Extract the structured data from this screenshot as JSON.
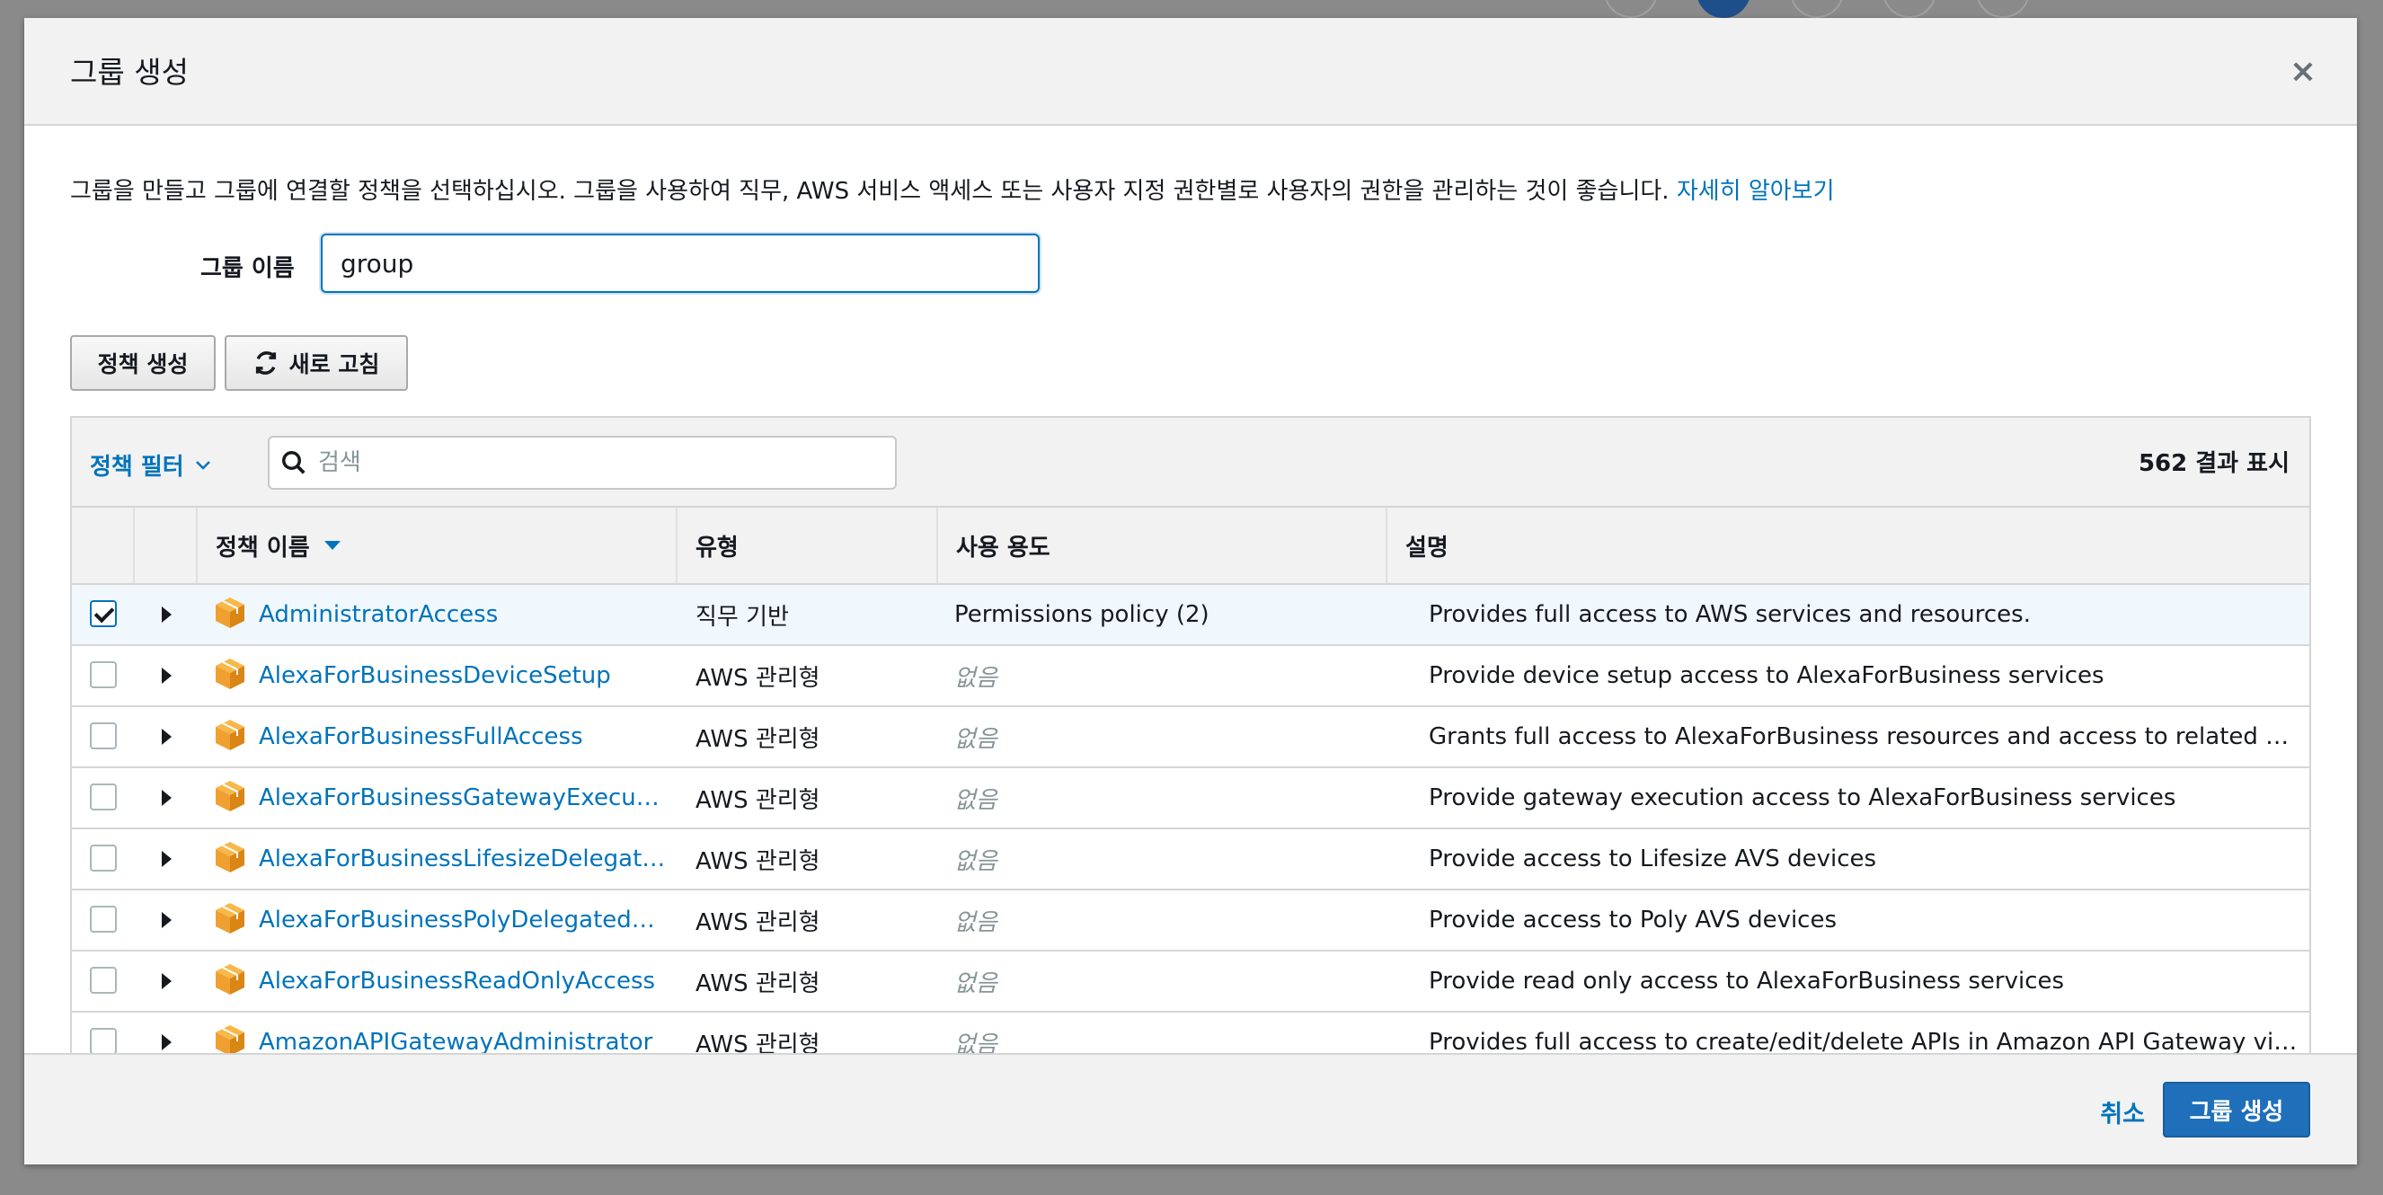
{
  "modal": {
    "title": "그룹 생성",
    "close_icon": "close-icon",
    "intro_text": "그룹을 만들고 그룹에 연결할 정책을 선택하십시오. 그룹을 사용하여 직무, AWS 서비스 액세스 또는 사용자 지정 권한별로 사용자의 권한을 관리하는 것이 좋습니다.",
    "learn_more": "자세히 알아보기"
  },
  "form": {
    "group_name_label": "그룹 이름",
    "group_name_value": "group"
  },
  "toolbar": {
    "create_policy": "정책 생성",
    "refresh": "새로 고침",
    "refresh_icon": "refresh-icon"
  },
  "filter": {
    "toggle_label": "정책 필터",
    "search_placeholder": "검색",
    "result_count": "562 결과 표시"
  },
  "columns": {
    "name": "정책 이름",
    "type": "유형",
    "usage": "사용 용도",
    "description": "설명"
  },
  "rows": [
    {
      "checked": true,
      "name": "AdministratorAccess",
      "type": "직무 기반",
      "usage": "Permissions policy (2)",
      "usage_none": false,
      "description": "Provides full access to AWS services and resources."
    },
    {
      "checked": false,
      "name": "AlexaForBusinessDeviceSetup",
      "type": "AWS 관리형",
      "usage": "없음",
      "usage_none": true,
      "description": "Provide device setup access to AlexaForBusiness services"
    },
    {
      "checked": false,
      "name": "AlexaForBusinessFullAccess",
      "type": "AWS 관리형",
      "usage": "없음",
      "usage_none": true,
      "description": "Grants full access to AlexaForBusiness resources and access to related AW…"
    },
    {
      "checked": false,
      "name": "AlexaForBusinessGatewayExecu…",
      "type": "AWS 관리형",
      "usage": "없음",
      "usage_none": true,
      "description": "Provide gateway execution access to AlexaForBusiness services"
    },
    {
      "checked": false,
      "name": "AlexaForBusinessLifesizeDelegat…",
      "type": "AWS 관리형",
      "usage": "없음",
      "usage_none": true,
      "description": "Provide access to Lifesize AVS devices"
    },
    {
      "checked": false,
      "name": "AlexaForBusinessPolyDelegated…",
      "type": "AWS 관리형",
      "usage": "없음",
      "usage_none": true,
      "description": "Provide access to Poly AVS devices"
    },
    {
      "checked": false,
      "name": "AlexaForBusinessReadOnlyAccess",
      "type": "AWS 관리형",
      "usage": "없음",
      "usage_none": true,
      "description": "Provide read only access to AlexaForBusiness services"
    },
    {
      "checked": false,
      "name": "AmazonAPIGatewayAdministrator",
      "type": "AWS 관리형",
      "usage": "없음",
      "usage_none": true,
      "description": "Provides full access to create/edit/delete APIs in Amazon API Gateway via th…"
    }
  ],
  "footer": {
    "cancel": "취소",
    "create_group": "그룹 생성"
  },
  "colors": {
    "link": "#0073bb",
    "primary": "#1f6fba",
    "policy_icon": "#f0a030",
    "selected_row": "#f1f8fd"
  }
}
